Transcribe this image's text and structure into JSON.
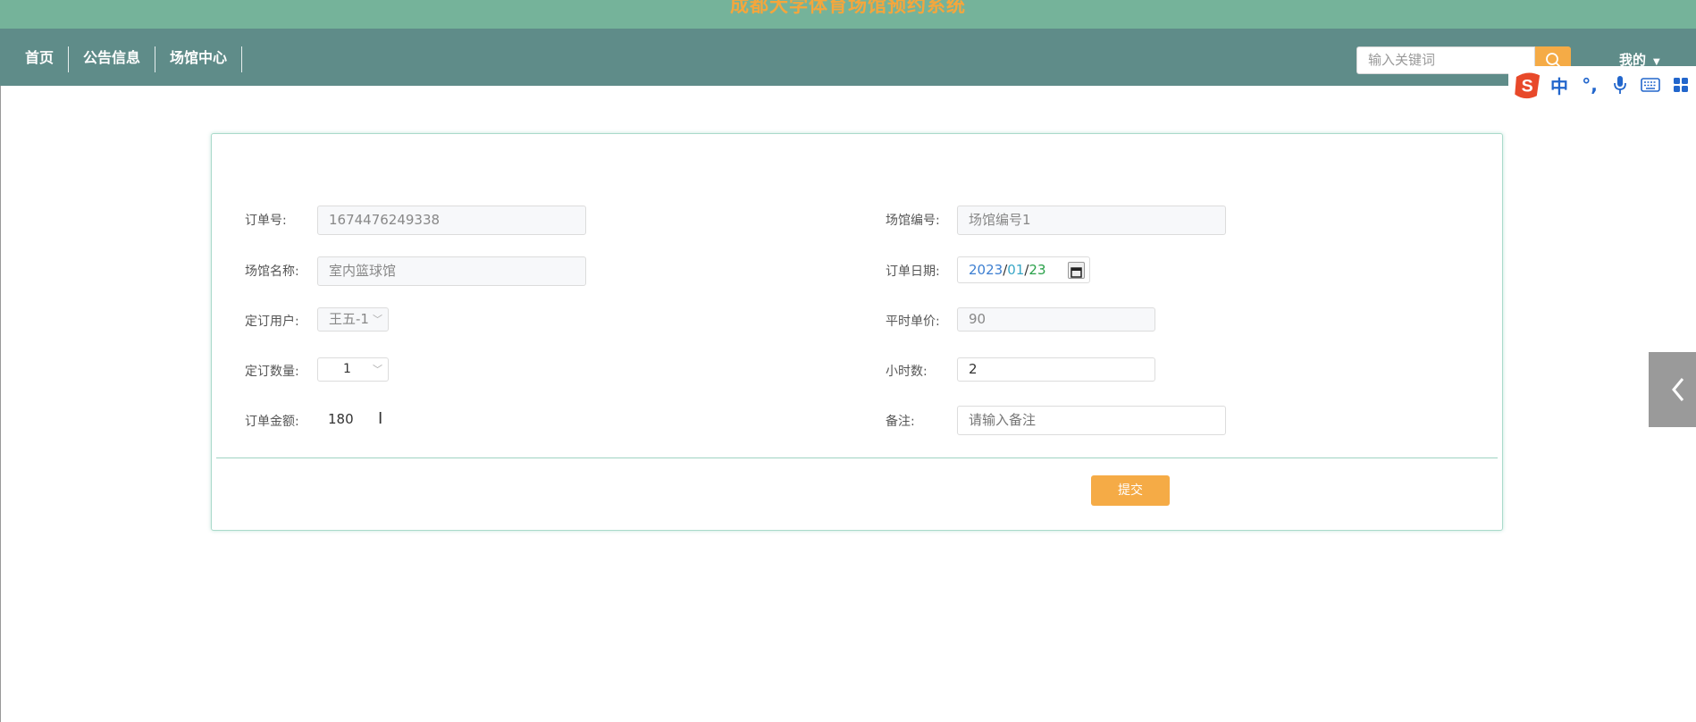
{
  "header": {
    "site_title": "成都大学体育场馆预约系统"
  },
  "nav": {
    "items": [
      {
        "label": "首页"
      },
      {
        "label": "公告信息"
      },
      {
        "label": "场馆中心"
      }
    ],
    "search_placeholder": "输入关键词",
    "mine_label": "我的",
    "accent": "#f5ab46"
  },
  "ime": {
    "items": [
      "sogou-logo",
      "中",
      "°,",
      "mic",
      "keyboard",
      "grid"
    ]
  },
  "form": {
    "order_no": {
      "label": "订单号:",
      "value": "1674476249338"
    },
    "venue_no": {
      "label": "场馆编号:",
      "value": "场馆编号1"
    },
    "venue_name": {
      "label": "场馆名称:",
      "value": "室内篮球馆"
    },
    "order_date": {
      "label": "订单日期:",
      "year": "2023",
      "sep": "/",
      "month": "01",
      "day": "23"
    },
    "booking_user": {
      "label": "定订用户:",
      "value": "王五-1"
    },
    "unit_price": {
      "label": "平时单价:",
      "value": "90"
    },
    "quantity": {
      "label": "定订数量:",
      "value": "1"
    },
    "hours": {
      "label": "小时数:",
      "value": "2"
    },
    "amount": {
      "label": "订单金额:",
      "value": "180"
    },
    "remark": {
      "label": "备注:",
      "placeholder": "请输入备注"
    },
    "submit_label": "提交"
  },
  "colors": {
    "banner": "#75b39a",
    "navbar": "#5f8c89",
    "title": "#f5a63c",
    "card_border": "#aadacb"
  }
}
